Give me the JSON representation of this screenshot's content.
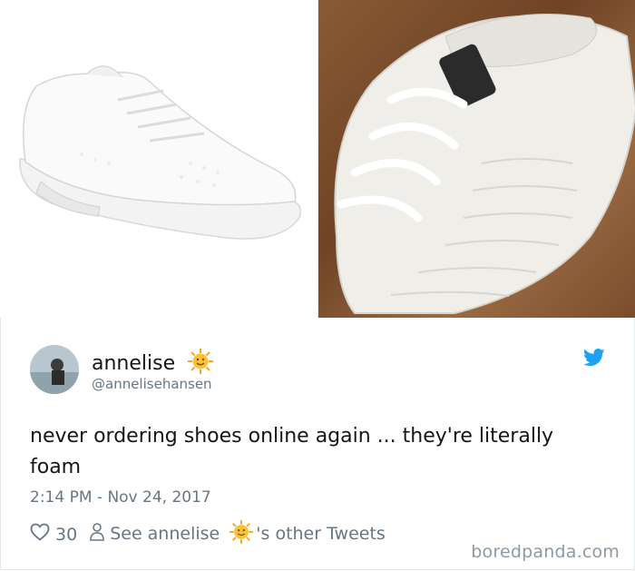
{
  "images": {
    "left_alt": "white mesh sneaker product photo",
    "right_alt": "white foam sneaker received"
  },
  "tweet": {
    "display_name": "annelise",
    "handle": "@annelisehansen",
    "text": "never ordering shoes online again ... they're literally foam",
    "timestamp": "2:14 PM - Nov 24, 2017",
    "likes": "30",
    "see_other_prefix": "See annelise",
    "see_other_suffix": "'s other Tweets"
  },
  "icons": {
    "emoji": "sun-with-face-icon",
    "brand": "twitter-bird-icon",
    "like": "heart-icon",
    "profile": "person-icon"
  },
  "colors": {
    "twitter_blue": "#1da1f2",
    "text": "#14171a",
    "muted": "#657786"
  },
  "watermark": "boredpanda.com"
}
